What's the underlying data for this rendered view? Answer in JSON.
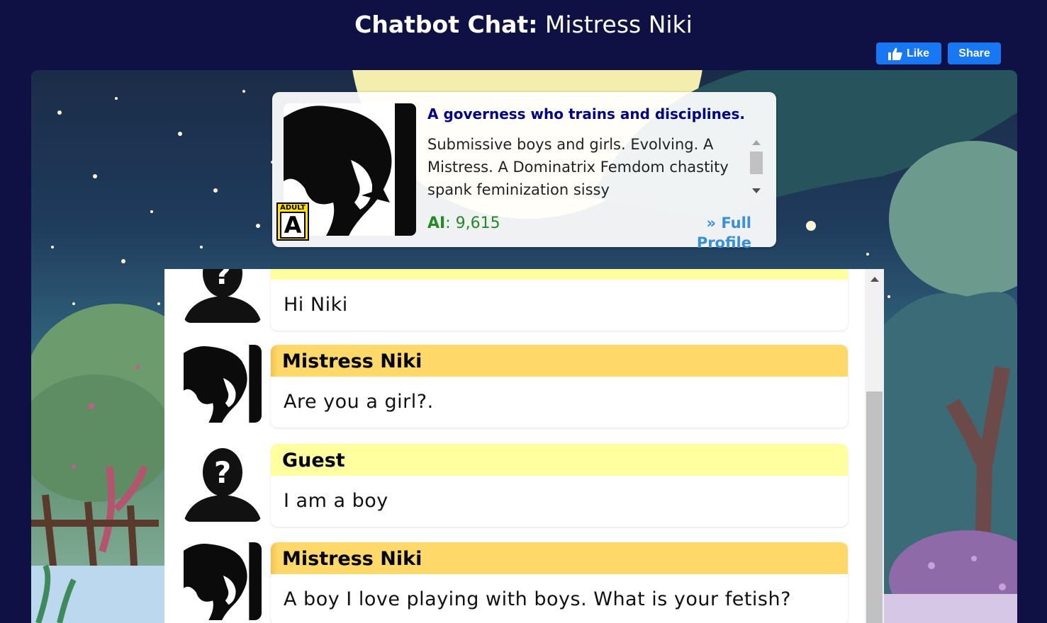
{
  "page": {
    "title_prefix": "Chatbot Chat:",
    "title_name": "Mistress Niki"
  },
  "social": {
    "like_label": "Like",
    "share_label": "Share",
    "brand_color": "#1877f2"
  },
  "profile": {
    "badge_label": "ADULT",
    "badge_letter": "A",
    "tagline": "A governess who trains and disciplines.",
    "description": "Submissive boys and girls. Evolving. A Mistress. A Dominatrix Femdom chastity spank feminization sissy",
    "ai_label": "AI",
    "ai_separator": ": ",
    "ai_value": "9,615",
    "full_profile_link": "» Full Profile"
  },
  "chat": {
    "partial_top": {
      "text": "Hi Niki",
      "avatar_icon": "guest-silhouette-icon"
    },
    "messages": [
      {
        "sender": "Mistress Niki",
        "role": "bot",
        "text": "Are you a girl?.",
        "avatar_icon": "bot-portrait-icon"
      },
      {
        "sender": "Guest",
        "role": "guest",
        "text": "I am a boy",
        "avatar_icon": "guest-silhouette-icon"
      },
      {
        "sender": "Mistress Niki",
        "role": "bot",
        "text": "A boy I love playing with boys. What is your fetish?",
        "avatar_icon": "bot-portrait-icon"
      }
    ]
  },
  "colors": {
    "page_bg": "#0f1145",
    "bot_header": "#ffd86a",
    "guest_header": "#ffff9f",
    "tagline": "#00008b",
    "ai_count": "#228b22",
    "link": "#3a8fd9"
  }
}
